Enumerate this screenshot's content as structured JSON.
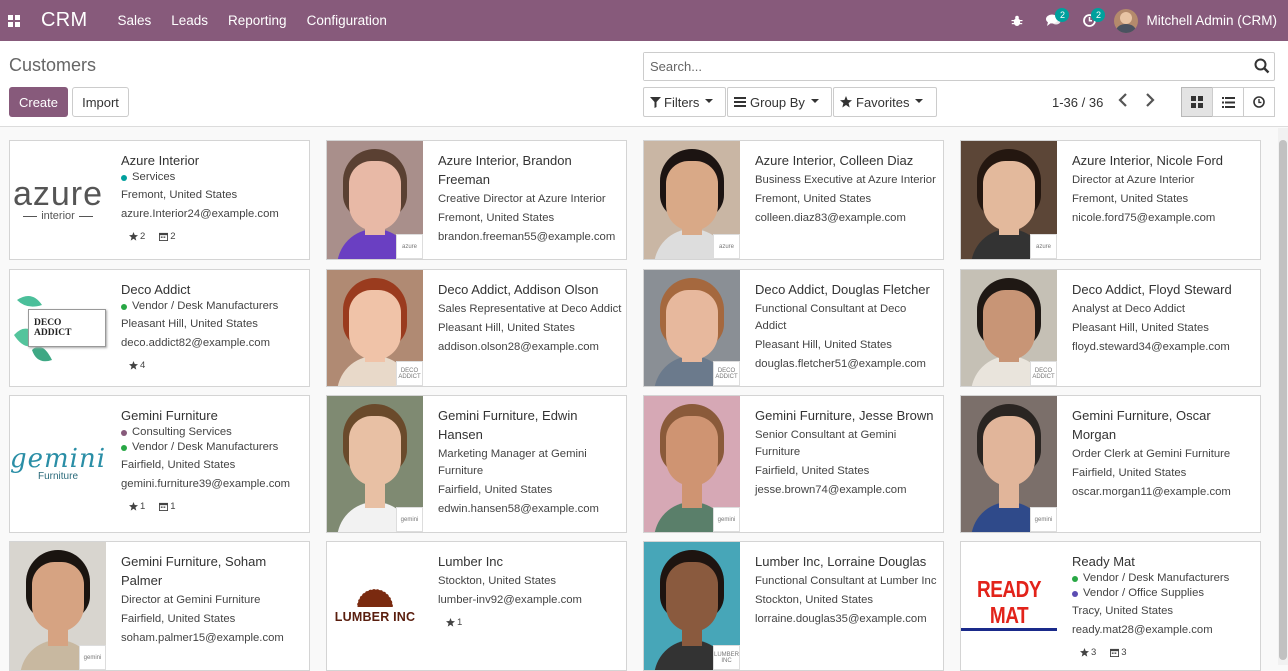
{
  "topbar": {
    "brand": "CRM",
    "menu": [
      "Sales",
      "Leads",
      "Reporting",
      "Configuration"
    ],
    "messages_count": "2",
    "activities_count": "2",
    "user": "Mitchell Admin (CRM)"
  },
  "control": {
    "title": "Customers",
    "create": "Create",
    "import": "Import",
    "search_placeholder": "Search...",
    "filters": "Filters",
    "group_by": "Group By",
    "favorites": "Favorites",
    "pager": "1-36 / 36"
  },
  "colors": {
    "brand": "#875a7b",
    "teal": "#00a09d",
    "services": "#00a09d",
    "vendor": "#28a745",
    "consulting": "#875a7b",
    "office": "#5b4cb2"
  },
  "cards": [
    {
      "name": "Azure Interior",
      "tags": [
        {
          "label": "Services",
          "color": "#00a09d"
        }
      ],
      "lines": [
        "Fremont, United States",
        "azure.Interior24@example.com"
      ],
      "stars": "2",
      "cal": "2",
      "logo": "azure"
    },
    {
      "name": "Azure Interior, Brandon Freeman",
      "lines": [
        "Creative Director at Azure Interior",
        "Fremont, United States",
        "brandon.freeman55@example.com"
      ],
      "mini": "azure"
    },
    {
      "name": "Azure Interior, Colleen Diaz",
      "lines": [
        "Business Executive at Azure Interior",
        "Fremont, United States",
        "colleen.diaz83@example.com"
      ],
      "mini": "azure"
    },
    {
      "name": "Azure Interior, Nicole Ford",
      "lines": [
        "Director at Azure Interior",
        "Fremont, United States",
        "nicole.ford75@example.com"
      ],
      "mini": "azure"
    },
    {
      "name": "Deco Addict",
      "tags": [
        {
          "label": "Vendor / Desk Manufacturers",
          "color": "#28a745"
        }
      ],
      "lines": [
        "Pleasant Hill, United States",
        "deco.addict82@example.com"
      ],
      "stars": "4",
      "logo": "deco"
    },
    {
      "name": "Deco Addict, Addison Olson",
      "lines": [
        "Sales Representative at Deco Addict",
        "Pleasant Hill, United States",
        "addison.olson28@example.com"
      ],
      "mini": "deco"
    },
    {
      "name": "Deco Addict, Douglas Fletcher",
      "lines": [
        "Functional Consultant at Deco Addict",
        "Pleasant Hill, United States",
        "douglas.fletcher51@example.com"
      ],
      "mini": "deco"
    },
    {
      "name": "Deco Addict, Floyd Steward",
      "lines": [
        "Analyst at Deco Addict",
        "Pleasant Hill, United States",
        "floyd.steward34@example.com"
      ],
      "mini": "deco"
    },
    {
      "name": "Gemini Furniture",
      "tags": [
        {
          "label": "Consulting Services",
          "color": "#875a7b"
        },
        {
          "label": "Vendor / Desk Manufacturers",
          "color": "#28a745"
        }
      ],
      "lines": [
        "Fairfield, United States",
        "gemini.furniture39@example.com"
      ],
      "stars": "1",
      "cal": "1",
      "logo": "gemini"
    },
    {
      "name": "Gemini Furniture, Edwin Hansen",
      "lines": [
        "Marketing Manager at Gemini Furniture",
        "Fairfield, United States",
        "edwin.hansen58@example.com"
      ],
      "mini": "gemini"
    },
    {
      "name": "Gemini Furniture, Jesse Brown",
      "lines": [
        "Senior Consultant at Gemini Furniture",
        "Fairfield, United States",
        "jesse.brown74@example.com"
      ],
      "mini": "gemini"
    },
    {
      "name": "Gemini Furniture, Oscar Morgan",
      "lines": [
        "Order Clerk at Gemini Furniture",
        "Fairfield, United States",
        "oscar.morgan11@example.com"
      ],
      "mini": "gemini"
    },
    {
      "name": "Gemini Furniture, Soham Palmer",
      "lines": [
        "Director at Gemini Furniture",
        "Fairfield, United States",
        "soham.palmer15@example.com"
      ],
      "mini": "gemini"
    },
    {
      "name": "Lumber Inc",
      "lines": [
        "Stockton, United States",
        "lumber-inv92@example.com"
      ],
      "stars": "1",
      "logo": "lumber"
    },
    {
      "name": "Lumber Inc, Lorraine Douglas",
      "lines": [
        "Functional Consultant at Lumber Inc",
        "Stockton, United States",
        "lorraine.douglas35@example.com"
      ],
      "mini": "lumber"
    },
    {
      "name": "Ready Mat",
      "tags": [
        {
          "label": "Vendor / Desk Manufacturers",
          "color": "#28a745"
        },
        {
          "label": "Vendor / Office Supplies",
          "color": "#5b4cb2"
        }
      ],
      "lines": [
        "Tracy, United States",
        "ready.mat28@example.com"
      ],
      "stars": "3",
      "cal": "3",
      "logo": "readymat"
    }
  ],
  "logos": {
    "azure_big": "azure",
    "azure_sub": "interior",
    "deco": "DECO ADDICT",
    "gemini": "gemini",
    "gemini_sub": "Furniture",
    "lumber": "LUMBER INC",
    "readymat": "READY MAT"
  }
}
